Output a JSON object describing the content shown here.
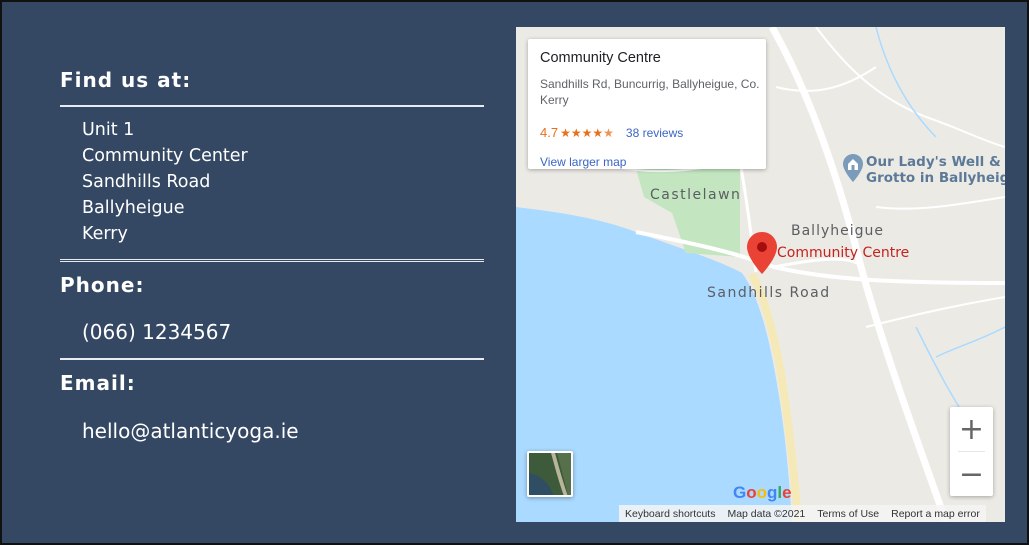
{
  "contact": {
    "find_heading": "Find us at:",
    "address_lines": [
      "Unit 1",
      "Community Center",
      "Sandhills Road",
      "Ballyheigue",
      "Kerry"
    ],
    "phone_heading": "Phone:",
    "phone": "(066) 1234567",
    "email_heading": "Email:",
    "email": "hello@atlanticyoga.ie"
  },
  "map": {
    "card": {
      "title": "Community Centre",
      "address": "Sandhills Rd, Buncurrig, Ballyheigue, Co. Kerry",
      "rating": "4.7",
      "stars": 4.7,
      "reviews": "38 reviews",
      "larger_map": "View larger map"
    },
    "labels": {
      "castlelawn": "Castlelawn",
      "ballyheigue": "Ballyheigue",
      "place": "Community Centre",
      "road": "Sandhills Road",
      "poi_line1": "Our Lady's Well &",
      "poi_line2": "Grotto in Ballyheigue"
    },
    "zoom_in": "+",
    "zoom_out": "−",
    "google_logo": [
      "G",
      "o",
      "o",
      "g",
      "l",
      "e"
    ],
    "google_colors": [
      "#4285f4",
      "#ea4335",
      "#fbbc05",
      "#4285f4",
      "#34a853",
      "#ea4335"
    ],
    "footer": {
      "keyboard": "Keyboard shortcuts",
      "map_data": "Map data ©2021",
      "terms": "Terms of Use",
      "report": "Report a map error"
    },
    "colors": {
      "water": "#aadaff",
      "land": "#eceae5",
      "park": "#c3e6c0",
      "pin": "#ea4335",
      "link": "#3a66c4",
      "rating": "#e7711b"
    }
  }
}
